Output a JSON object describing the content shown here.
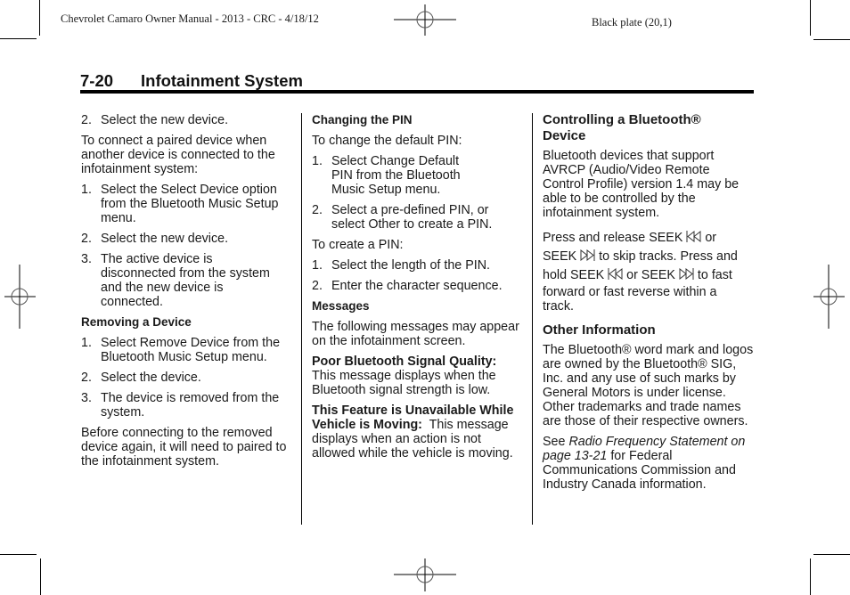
{
  "print_header": {
    "left": "Chevrolet Camaro Owner Manual - 2013 - CRC - 4/18/12",
    "right": "Black plate (20,1)"
  },
  "page_heading": {
    "page_number": "7-20",
    "title": "Infotainment System"
  },
  "column1": {
    "item_top": {
      "n": "2.",
      "text": "Select the new device."
    },
    "intro": "To connect a paired device when another device is connected to the infotainment system:",
    "steps": [
      {
        "n": "1.",
        "text": "Select the Select Device option from the Bluetooth Music Setup menu."
      },
      {
        "n": "2.",
        "text": "Select the new device."
      },
      {
        "n": "3.",
        "text": "The active device is disconnected from the system and the new device is connected."
      }
    ],
    "removing_heading": "Removing a Device",
    "removing_steps": [
      {
        "n": "1.",
        "text": "Select Remove Device from the Bluetooth Music Setup menu."
      },
      {
        "n": "2.",
        "text": "Select the device."
      },
      {
        "n": "3.",
        "text": "The device is removed from the system."
      }
    ],
    "closing": "Before connecting to the removed device again, it will need to paired to the infotainment system."
  },
  "column2": {
    "pin_heading": "Changing the PIN",
    "pin_intro": "To change the default PIN:",
    "pin_steps": [
      {
        "n": "1.",
        "text": "Select Change Default PIN from the Bluetooth Music Setup menu."
      },
      {
        "n": "2.",
        "text": "Select a pre-defined PIN, or select Other to create a PIN."
      }
    ],
    "create_intro": "To create a PIN:",
    "create_steps": [
      {
        "n": "1.",
        "text": "Select the length of the PIN."
      },
      {
        "n": "2.",
        "text": "Enter the character sequence."
      }
    ],
    "messages_heading": "Messages",
    "messages_intro": "The following messages may appear on the infotainment screen.",
    "msg1_label": "Poor Bluetooth Signal Quality:",
    "msg1_text": "This message displays when the Bluetooth signal strength is low.",
    "msg2_label": "This Feature is Unavailable While Vehicle is Moving:",
    "msg2_text": "This message displays when an action is not allowed while the vehicle is moving."
  },
  "column3": {
    "control_heading": "Controlling a Bluetooth® Device",
    "control_text": "Bluetooth devices that support AVRCP (Audio/Video Remote Control Profile) version 1.4 may be able to be controlled by the infotainment system.",
    "seek": {
      "line1_a": "Press and release SEEK",
      "line1_b": "or",
      "line2_a": "SEEK",
      "line2_b": "to skip tracks. Press and",
      "line3_a": "hold SEEK",
      "line3_b": "or SEEK",
      "line3_c": "to fast",
      "line4": "forward or fast reverse within a track.",
      "icon_back": "seek-back-icon",
      "icon_forward": "seek-forward-icon"
    },
    "other_heading": "Other Information",
    "other_text": "The Bluetooth® word mark and logos are owned by the Bluetooth® SIG, Inc. and any use of such marks by General Motors is under license. Other trademarks and trade names are those of their respective owners.",
    "see_prefix": "See",
    "see_ref": "Radio Frequency Statement on page 13-21",
    "see_suffix": "for Federal Communications Commission and Industry Canada information."
  }
}
